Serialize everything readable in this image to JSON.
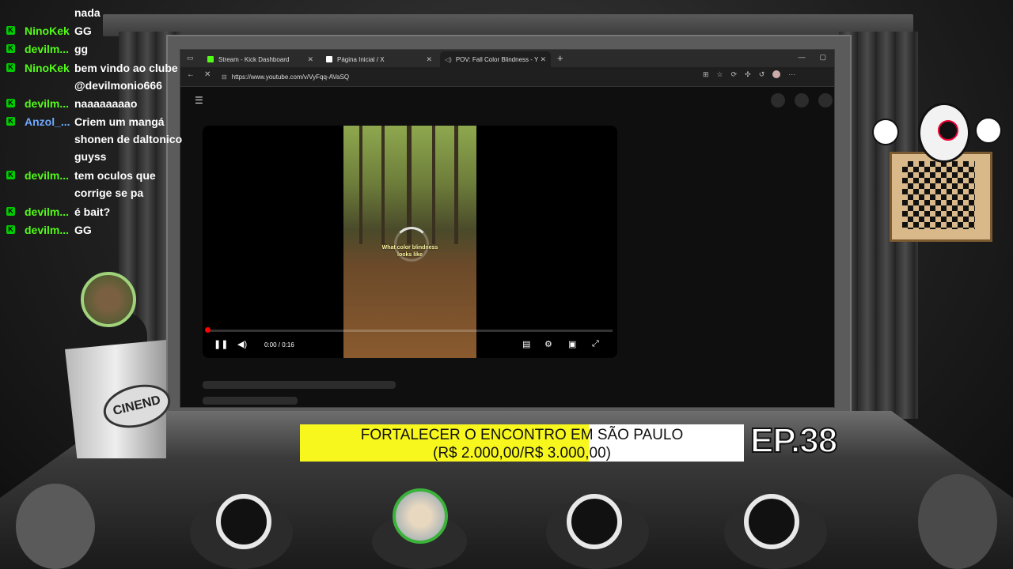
{
  "browser": {
    "tabs": [
      {
        "label": "Stream - Kick Dashboard",
        "favicon_color": "#53fc18"
      },
      {
        "label": "Página Inicial / X",
        "favicon_color": "#ffffff"
      },
      {
        "label": "POV: Fall Color Blindness - Y",
        "favicon_color": "#ff0000"
      }
    ],
    "url": "https://www.youtube.com/v/VyFqq-AVaSQ",
    "window_controls": [
      "—",
      "▢"
    ]
  },
  "player": {
    "caption_line1": "What color blindness",
    "caption_line2": "looks like",
    "time": "0:00 / 0:16",
    "progress_fraction": 0.0
  },
  "chat": {
    "messages": [
      {
        "user": "",
        "text": "nada"
      },
      {
        "user": "NinoKek",
        "text": "GG"
      },
      {
        "user": "devilm...",
        "text": "gg"
      },
      {
        "user": "NinoKek",
        "text": "bem vindo ao clube @devilmonio666"
      },
      {
        "user": "devilm...",
        "text": "naaaaaaaao"
      },
      {
        "user": "Anzol_...",
        "text": "Criem um mangá shonen de daltonico guyss"
      },
      {
        "user": "devilm...",
        "text": "tem oculos que corrige se pa"
      },
      {
        "user": "devilm...",
        "text": "é bait?"
      },
      {
        "user": "devilm...",
        "text": "GG"
      }
    ],
    "badge": "K"
  },
  "overlay": {
    "podium_logo": "CINEND",
    "banner_line1": "FORTALECER O ENCONTRO EM SÃO PAULO",
    "banner_line2": "(R$ 2.000,00/R$ 3.000,00)",
    "goal_progress_fraction": 0.65,
    "episode": "EP.38"
  },
  "colors": {
    "kick_green": "#53fc18",
    "banner_yellow": "#f7f71e",
    "anzol_name": "#6fa8ff"
  }
}
